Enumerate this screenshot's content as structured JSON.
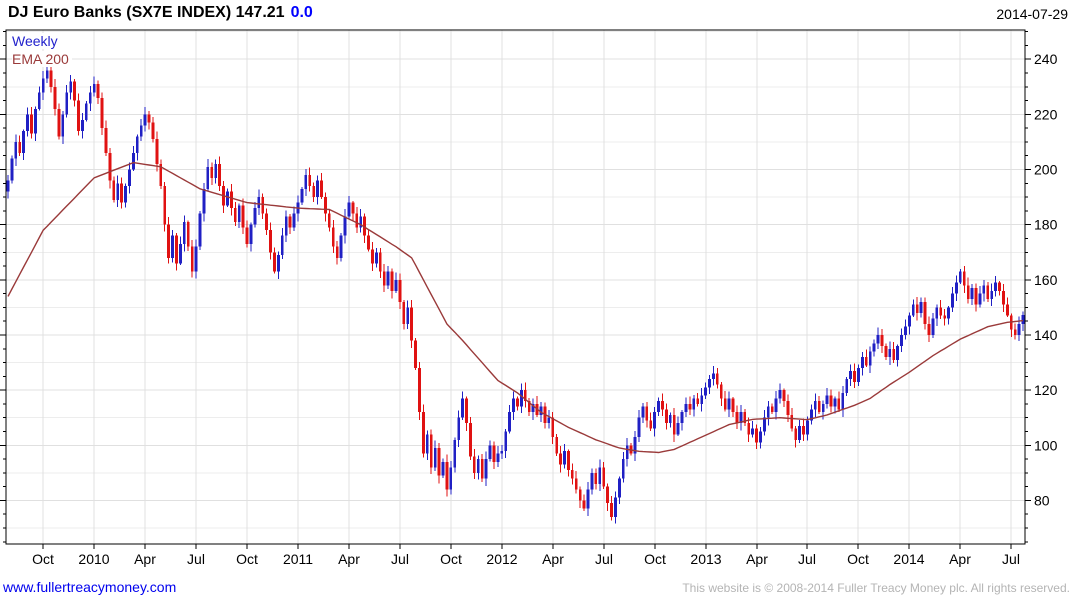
{
  "header": {
    "title": "DJ Euro Banks (SX7E INDEX) 147.21",
    "change": "0.0",
    "date": "2014-07-29"
  },
  "legend": {
    "timeframe": "Weekly",
    "overlay": "EMA 200"
  },
  "footer": {
    "site_link": "www.fullertreacymoney.com",
    "copyright": "This website is © 2008-2014 Fuller Treacy Money plc. All rights reserved."
  },
  "colors": {
    "up": "#2020c4",
    "down": "#e01212",
    "ema": "#9a3a3a",
    "grid_minor": "#ededed",
    "grid_major": "#e0e0e0",
    "axis": "#000000",
    "change_blue": "#0000ff",
    "link_blue": "#0000ee",
    "copyright_gray": "#b4b4b4"
  },
  "chart_data": {
    "type": "candlestick",
    "title": "DJ Euro Banks (SX7E INDEX)",
    "last_price": 147.21,
    "change": 0.0,
    "timeframe": "Weekly",
    "overlay": "EMA 200",
    "ylim": [
      64.2,
      250.6
    ],
    "y_axis_side": "right",
    "y_major_ticks": [
      80,
      100,
      120,
      140,
      160,
      180,
      200,
      220,
      240
    ],
    "y_grid_step": 10,
    "y_minor_tick_step": 5,
    "grid": true,
    "weeks": 260,
    "x_ticks": [
      {
        "week": 9,
        "label": "Oct"
      },
      {
        "week": 22,
        "label": "2010"
      },
      {
        "week": 35,
        "label": "Apr"
      },
      {
        "week": 48,
        "label": "Jul"
      },
      {
        "week": 61,
        "label": "Oct"
      },
      {
        "week": 74,
        "label": "2011"
      },
      {
        "week": 87,
        "label": "Apr"
      },
      {
        "week": 100,
        "label": "Jul"
      },
      {
        "week": 113,
        "label": "Oct"
      },
      {
        "week": 126,
        "label": "2012"
      },
      {
        "week": 139,
        "label": "Apr"
      },
      {
        "week": 152,
        "label": "Jul"
      },
      {
        "week": 165,
        "label": "Oct"
      },
      {
        "week": 178,
        "label": "2013"
      },
      {
        "week": 191,
        "label": "Apr"
      },
      {
        "week": 204,
        "label": "Jul"
      },
      {
        "week": 217,
        "label": "Oct"
      },
      {
        "week": 230,
        "label": "2014"
      },
      {
        "week": 243,
        "label": "Apr"
      },
      {
        "week": 256,
        "label": "Jul"
      }
    ],
    "closes": [
      196,
      204,
      210,
      206,
      214,
      220,
      213,
      222,
      228,
      233,
      236,
      230,
      222,
      212,
      220,
      228,
      232,
      225,
      214,
      218,
      224,
      228,
      231,
      226,
      215,
      206,
      196,
      189,
      195,
      188,
      194,
      200,
      206,
      212,
      216,
      220,
      217,
      211,
      202,
      194,
      180,
      168,
      176,
      166,
      173,
      181,
      172,
      163,
      172,
      184,
      193,
      201,
      197,
      202,
      194,
      187,
      192,
      186,
      181,
      187,
      179,
      173,
      180,
      186,
      190,
      184,
      178,
      170,
      163,
      169,
      176,
      183,
      179,
      184,
      188,
      193,
      198,
      194,
      190,
      196,
      190,
      184,
      179,
      172,
      168,
      176,
      183,
      188,
      184,
      179,
      183,
      176,
      171,
      166,
      170,
      163,
      158,
      163,
      156,
      160,
      152,
      144,
      150,
      138,
      128,
      112,
      97,
      104,
      92,
      99,
      89,
      94,
      84,
      92,
      102,
      110,
      117,
      108,
      96,
      90,
      95,
      88,
      95,
      100,
      94,
      97,
      98,
      105,
      112,
      117,
      114,
      120,
      116,
      112,
      115,
      111,
      114,
      108,
      110,
      103,
      97,
      93,
      98,
      91,
      88,
      84,
      80,
      77,
      84,
      90,
      86,
      92,
      85,
      79,
      74,
      81,
      88,
      95,
      100,
      97,
      103,
      110,
      114,
      109,
      106,
      112,
      116,
      113,
      108,
      111,
      104,
      108,
      112,
      115,
      113,
      117,
      115,
      118,
      121,
      124,
      126,
      122,
      117,
      113,
      117,
      112,
      108,
      112,
      108,
      104,
      106,
      101,
      105,
      110,
      114,
      112,
      117,
      120,
      116,
      111,
      106,
      102,
      107,
      104,
      109,
      113,
      116,
      112,
      115,
      118,
      114,
      117,
      113,
      119,
      124,
      127,
      123,
      128,
      132,
      129,
      134,
      137,
      140,
      136,
      132,
      135,
      131,
      136,
      140,
      143,
      147,
      151,
      148,
      152,
      144,
      140,
      146,
      150,
      147,
      146,
      150,
      155,
      159,
      163,
      158,
      153,
      157,
      151,
      155,
      158,
      153,
      156,
      159,
      156,
      151,
      147,
      142,
      140,
      144,
      147.21
    ],
    "ema_anchors": [
      [
        0,
        154
      ],
      [
        9,
        178
      ],
      [
        22,
        197
      ],
      [
        32,
        202.5
      ],
      [
        39,
        201
      ],
      [
        49,
        193
      ],
      [
        61,
        188
      ],
      [
        74,
        186
      ],
      [
        82,
        185.5
      ],
      [
        90,
        180
      ],
      [
        99,
        172
      ],
      [
        103,
        168
      ],
      [
        112,
        144
      ],
      [
        116,
        138
      ],
      [
        125,
        123.5
      ],
      [
        130,
        119
      ],
      [
        136,
        112
      ],
      [
        143,
        106.5
      ],
      [
        150,
        102
      ],
      [
        156,
        99
      ],
      [
        161,
        97.8
      ],
      [
        166,
        97.4
      ],
      [
        170,
        98.5
      ],
      [
        177,
        103
      ],
      [
        184,
        107.5
      ],
      [
        190,
        109.4
      ],
      [
        197,
        110
      ],
      [
        204,
        109.3
      ],
      [
        209,
        111
      ],
      [
        216,
        114.5
      ],
      [
        220,
        117
      ],
      [
        225,
        122
      ],
      [
        230,
        126.5
      ],
      [
        236,
        132.5
      ],
      [
        243,
        138.5
      ],
      [
        250,
        143
      ],
      [
        255,
        144.6
      ],
      [
        259,
        145.2
      ]
    ]
  }
}
